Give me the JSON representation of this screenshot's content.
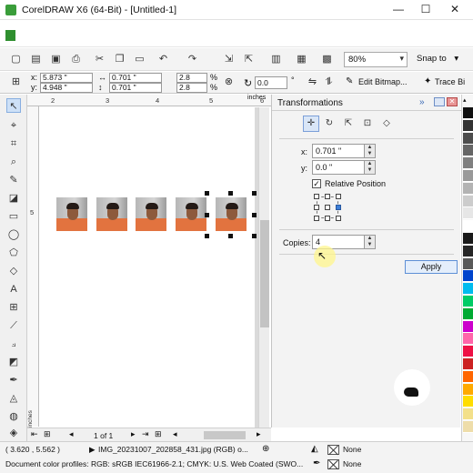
{
  "window": {
    "title": "CorelDRAW X6 (64-Bit) - [Untitled-1]",
    "minimize": "—",
    "maximize": "☐",
    "close": "✕"
  },
  "toolbar": {
    "zoom_value": "80%",
    "snap_to": "Snap to",
    "snap_arrow": "▾"
  },
  "property_bar": {
    "x_label": "x:",
    "x_value": "5.873 \"",
    "y_label": "y:",
    "y_value": "4.948 \"",
    "width_value": "0.701 \"",
    "height_value": "0.701 \"",
    "scale_x": "2.8",
    "scale_y": "2.8",
    "percent": "%",
    "rotation_value": "0.0",
    "degree": "°",
    "edit_bitmap": "Edit Bitmap...",
    "trace_bitmap": "Trace Bi"
  },
  "ruler": {
    "top_ticks": [
      "2",
      "3",
      "4",
      "5",
      "6"
    ],
    "unit": "inches",
    "left_ticks": [
      "5"
    ],
    "left_unit": "inches"
  },
  "page_nav": {
    "page_of": "1 of 1"
  },
  "docker": {
    "title": "Transformations",
    "expand": "»",
    "x_label": "x:",
    "x_value": "0.701 \"",
    "y_label": "y:",
    "y_value": "0.0 \"",
    "relative_position_label": "Relative Position",
    "relative_position_checked": "✓",
    "copies_label": "Copies:",
    "copies_value": "4",
    "apply_label": "Apply"
  },
  "status": {
    "coordinates": "( 3.620 , 5.562 )",
    "file_info": "IMG_20231007_202858_431.jpg (RGB) o...",
    "color_profiles": "Document color profiles: RGB: sRGB IEC61966-2.1; CMYK: U.S. Web Coated (SWO...",
    "fill_none": "None",
    "outline_none": "None"
  },
  "palette": {
    "colors": [
      "#111111",
      "#333333",
      "#4d4d4d",
      "#666666",
      "#808080",
      "#999999",
      "#b3b3b3",
      "#cccccc",
      "#e6e6e6",
      "#ffffff",
      "#1a1a1a",
      "#262626",
      "#595959",
      "#0044cc",
      "#00bbee",
      "#00cc66",
      "#00aa33",
      "#cc00cc",
      "#ff66aa",
      "#ee1144",
      "#cc2222",
      "#ff6600",
      "#ffaa00",
      "#ffdd00",
      "#f3e08a",
      "#eeddaa"
    ]
  }
}
